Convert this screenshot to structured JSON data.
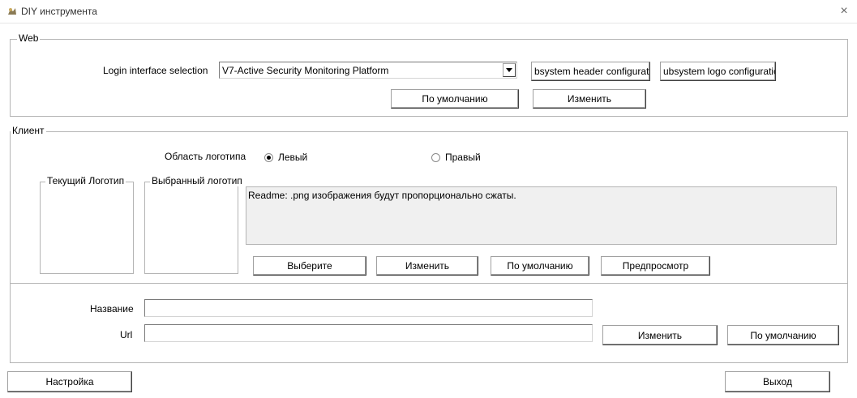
{
  "window": {
    "title": "DIY инструмента",
    "close_glyph": "×",
    "icon": "app-icon"
  },
  "web": {
    "group_title": "Web",
    "login_label": "Login interface selection",
    "login_selected": "V7-Active Security Monitoring Platform",
    "header_config_label": "bsystem header configurat",
    "logo_config_label": "ubsystem logo configuratic",
    "default_label": "По умолчанию",
    "modify_label": "Изменить"
  },
  "client": {
    "group_title": "Клиент",
    "logo_area_label": "Область логотипа",
    "radio_left_label": "Левый",
    "radio_right_label": "Правый",
    "selected_position": "left",
    "current_logo_title": "Текущий Логотип",
    "selected_logo_title": "Выбранный логотип",
    "readme": "Readme: .png изображения будут пропорционально сжаты.",
    "buttons": {
      "select": "Выберите",
      "modify": "Изменить",
      "default": "По умолчанию",
      "preview": "Предпросмотр"
    },
    "name_label": "Название",
    "name_value": "",
    "url_label": "Url",
    "url_value": "",
    "url_modify": "Изменить",
    "url_default": "По умолчанию"
  },
  "footer": {
    "settings_label": "Настройка",
    "exit_label": "Выход"
  }
}
